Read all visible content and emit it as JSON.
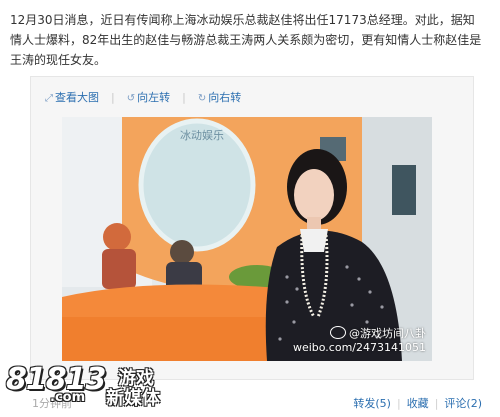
{
  "post": {
    "text": "12月30日消息，近日有传闻称上海冰动娱乐总裁赵佳将出任17173总经理。对此，据知情人士爆料，82年出生的赵佳与畅游总裁王涛两人关系颇为密切，更有知情人士称赵佳是王涛的现任女友。"
  },
  "media_toolbar": {
    "view_large": "查看大图",
    "rotate_left": "向左转",
    "rotate_right": "向右转"
  },
  "photo": {
    "sign_text": "冰动娱乐",
    "watermark_handle": "@游戏坊间八卦",
    "watermark_url": "weibo.com/2473141051"
  },
  "footer": {
    "time": "1分钟前",
    "repost": "转发(5)",
    "favorite": "收藏",
    "comment": "评论(2)"
  },
  "site_logo": {
    "number": "81813",
    "domain": ".com",
    "cn_line1": "游戏",
    "cn_line2": "新媒体"
  },
  "colors": {
    "link": "#2c6fb0",
    "orange_wall": "#f3a45c",
    "jacket": "#1d1d24"
  }
}
